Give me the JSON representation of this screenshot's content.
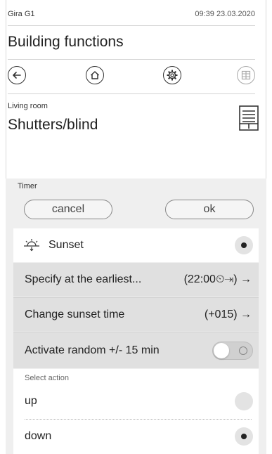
{
  "status_bar": {
    "device": "Gira G1",
    "datetime": "09:39 23.03.2020"
  },
  "header": {
    "title": "Building functions"
  },
  "nav": {
    "back_icon": "arrow-left-icon",
    "home_icon": "home-icon",
    "settings_icon": "gear-icon",
    "grid_icon": "grid-icon"
  },
  "room": {
    "label": "Living room",
    "device_title": "Shutters/blind",
    "device_icon": "blind-icon"
  },
  "timer": {
    "label": "Timer",
    "cancel_label": "cancel",
    "ok_label": "ok",
    "mode_label": "Sunset",
    "mode_icon": "sunset-icon",
    "rows": {
      "earliest_label": "Specify at the earliest...",
      "earliest_value": "(22:00⏲⇥) →",
      "change_label": "Change sunset time",
      "change_value": "(+015) →",
      "random_label": "Activate random +/- 15 min"
    },
    "random_enabled": false
  },
  "action": {
    "section_label": "Select action",
    "up_label": "up",
    "down_label": "down",
    "selected": "down"
  },
  "colors": {
    "panel_bg": "#efefef",
    "row_dark": "#e0e0e0",
    "text": "#222222"
  }
}
